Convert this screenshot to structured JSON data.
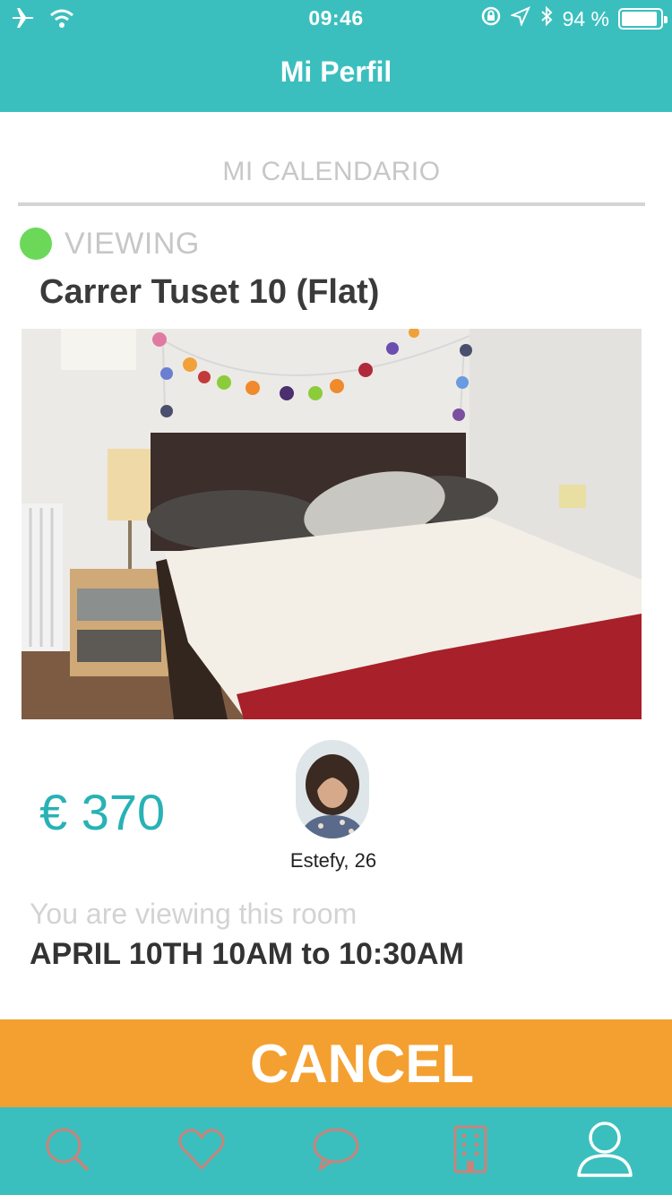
{
  "status_bar": {
    "time": "09:46",
    "battery_text": "94 %",
    "battery_level": 0.94,
    "icons": [
      "airplane-icon",
      "wifi-icon",
      "orientation-lock-icon",
      "location-icon",
      "bluetooth-icon",
      "battery-icon"
    ]
  },
  "header": {
    "title": "Mi Perfil"
  },
  "section": {
    "label": "MI CALENDARIO"
  },
  "listing": {
    "status": "VIEWING",
    "status_color": "#6bd85a",
    "title": "Carrer Tuset 10 (Flat)",
    "price": "€ 370",
    "host": "Estefy, 26"
  },
  "viewing": {
    "note": "You are viewing this room",
    "time": "APRIL 10TH 10AM to 10:30AM"
  },
  "actions": {
    "cancel_label": "CANCEL"
  },
  "tabs": [
    {
      "name": "search",
      "icon": "search-icon",
      "active": false
    },
    {
      "name": "favorites",
      "icon": "heart-icon",
      "active": false
    },
    {
      "name": "messages",
      "icon": "chat-bubble-icon",
      "active": false
    },
    {
      "name": "building",
      "icon": "building-icon",
      "active": false
    },
    {
      "name": "profile",
      "icon": "user-icon",
      "active": true
    }
  ],
  "colors": {
    "brand_teal": "#3bbfbe",
    "price_teal": "#28b2b5",
    "cancel_orange": "#f4a031",
    "tab_inactive": "#c9837a",
    "tab_active": "#ffffff"
  }
}
